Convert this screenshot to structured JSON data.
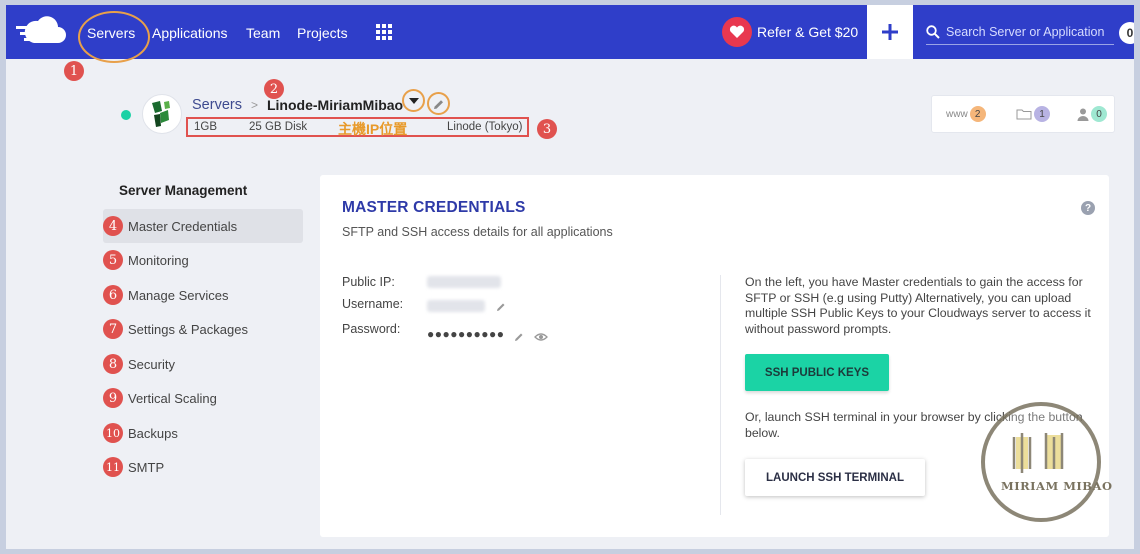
{
  "nav": {
    "items": [
      "Servers",
      "Applications",
      "Team",
      "Projects"
    ],
    "refer_label": "Refer & Get $20",
    "search_placeholder": "Search Server or Application",
    "notification_count": "0"
  },
  "annotations": {
    "n1": "1",
    "n2": "2",
    "n3": "3",
    "ip_note": "主機IP位置"
  },
  "server": {
    "breadcrumb_root": "Servers",
    "name": "Linode-MiriamMibao",
    "ram": "1GB",
    "disk": "25 GB Disk",
    "provider": "Linode (Tokyo)",
    "counts": {
      "www_label": "www",
      "www": "2",
      "folders": "1",
      "users": "0"
    }
  },
  "sidebar": {
    "title": "Server Management",
    "items": [
      {
        "num": "4",
        "label": "Master Credentials"
      },
      {
        "num": "5",
        "label": "Monitoring"
      },
      {
        "num": "6",
        "label": "Manage Services"
      },
      {
        "num": "7",
        "label": "Settings & Packages"
      },
      {
        "num": "8",
        "label": "Security"
      },
      {
        "num": "9",
        "label": "Vertical Scaling"
      },
      {
        "num": "10",
        "label": "Backups"
      },
      {
        "num": "11",
        "label": "SMTP"
      }
    ]
  },
  "card": {
    "title": "MASTER CREDENTIALS",
    "subtitle": "SFTP and SSH access details for all applications",
    "public_ip_label": "Public IP:",
    "username_label": "Username:",
    "password_label": "Password:",
    "password_dots": "●●●●●●●●●●",
    "info": "On the left, you have Master credentials to gain the access for SFTP or SSH (e.g using Putty) Alternatively, you can upload multiple SSH Public Keys to your Cloudways server to access it without password prompts.",
    "ssh_keys_button": "SSH PUBLIC KEYS",
    "info2": "Or, launch SSH terminal in your browser by clicking the button below.",
    "launch_button": "LAUNCH SSH TERMINAL"
  },
  "watermark": "MIRIAM MIBAO",
  "colors": {
    "nav": "#2f3ec9",
    "accent_green": "#1bd3a5",
    "annotation_red": "#e0524f",
    "annotation_orange": "#e8a04a"
  }
}
